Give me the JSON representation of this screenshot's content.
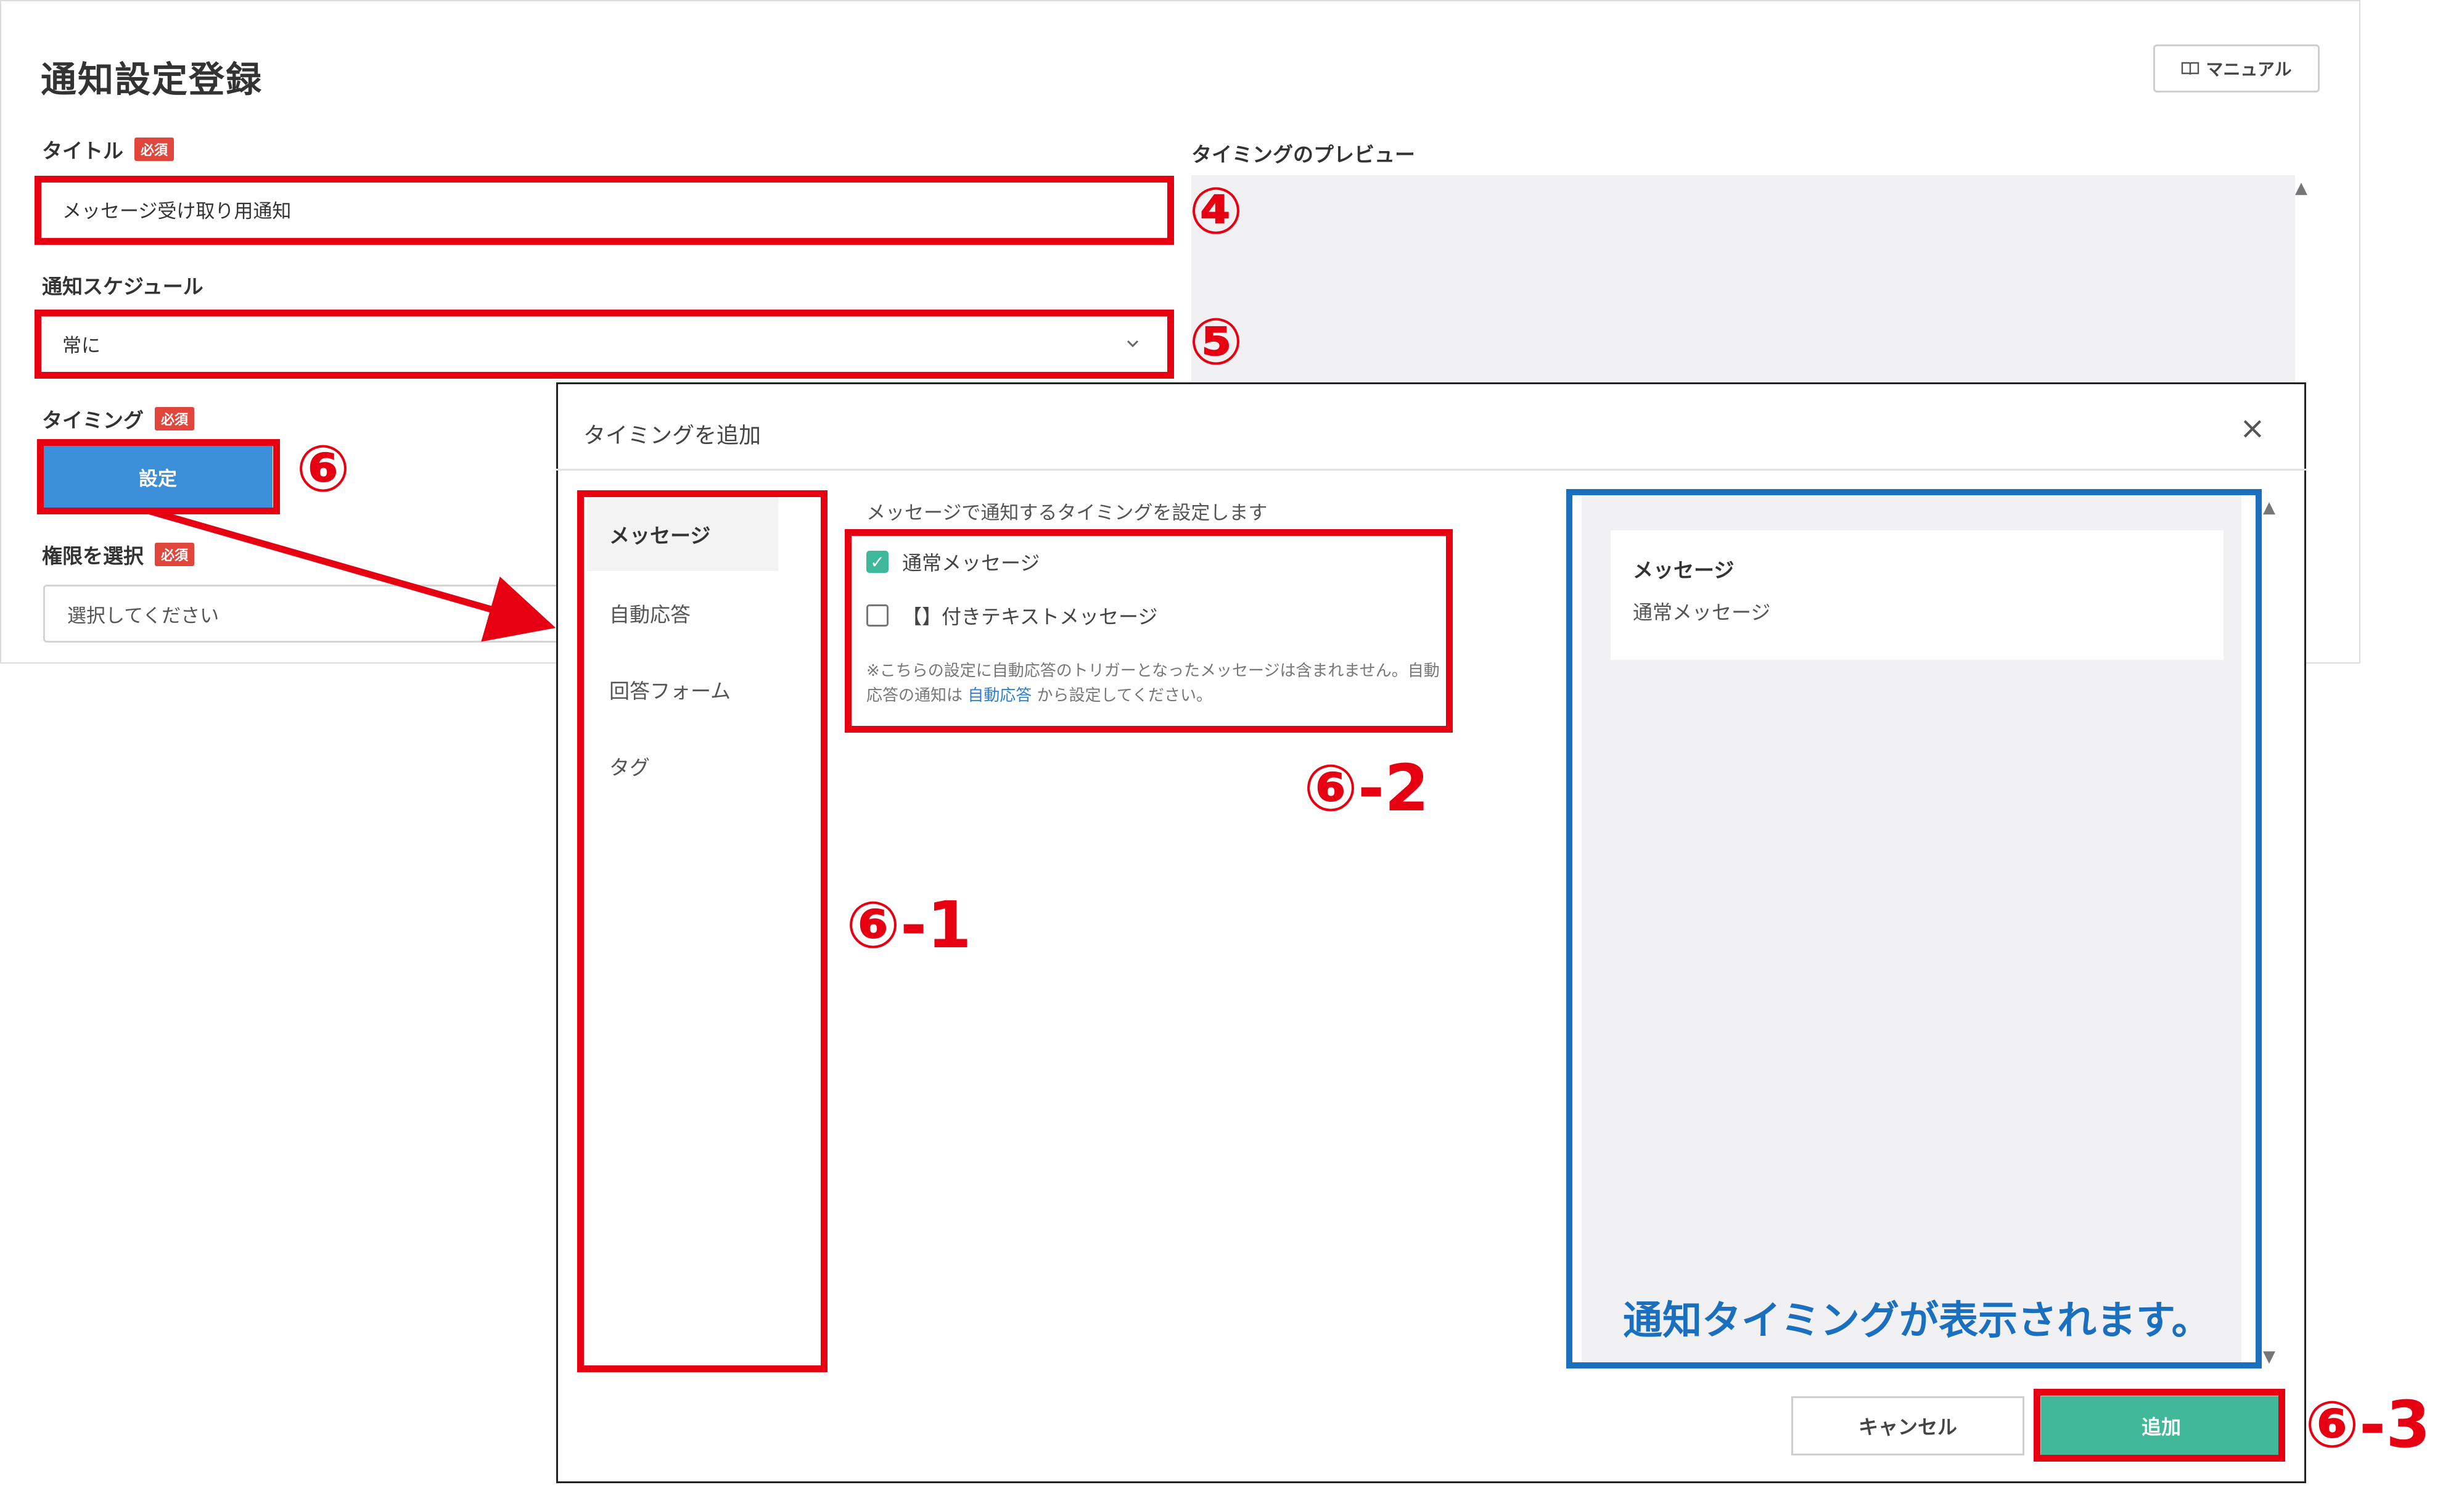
{
  "page": {
    "title": "通知設定登録",
    "manual_button": "マニュアル",
    "manual_icon": "book-icon",
    "fields": {
      "title_label": "タイトル",
      "required_badge": "必須",
      "title_value": "メッセージ受け取り用通知",
      "schedule_label": "通知スケジュール",
      "schedule_value": "常に",
      "timing_label": "タイミング",
      "set_button": "設定",
      "permission_label": "権限を選択",
      "permission_placeholder": "選択してください"
    },
    "preview_label": "タイミングのプレビュー"
  },
  "modal": {
    "title": "タイミングを追加",
    "close_icon": "×",
    "sidebar": [
      {
        "label": "メッセージ",
        "active": true
      },
      {
        "label": "自動応答",
        "active": false
      },
      {
        "label": "回答フォーム",
        "active": false
      },
      {
        "label": "タグ",
        "active": false
      }
    ],
    "description": "メッセージで通知するタイミングを設定します",
    "options": [
      {
        "label": "通常メッセージ",
        "checked": true
      },
      {
        "label": "【】付きテキストメッセージ",
        "checked": false
      }
    ],
    "note_before": "※こちらの設定に自動応答のトリガーとなったメッセージは含まれません。自動応答の通知は ",
    "note_link": "自動応答",
    "note_after": " から設定してください。",
    "preview": {
      "card_title": "メッセージ",
      "card_body": "通常メッセージ"
    },
    "cancel_button": "キャンセル",
    "add_button": "追加"
  },
  "annotations": {
    "label_4": "④",
    "label_5": "⑤",
    "label_6": "⑥",
    "label_6_1": "⑥-1",
    "label_6_2": "⑥-2",
    "label_6_3": "⑥-3",
    "blue_caption": "通知タイミングが表示されます。",
    "red": "#e60012",
    "blue": "#1b6fbf"
  },
  "colors": {
    "primary_button": "#3b8fd9",
    "add_button": "#40b899",
    "required_badge": "#e1453b",
    "link": "#2f7fd0"
  }
}
